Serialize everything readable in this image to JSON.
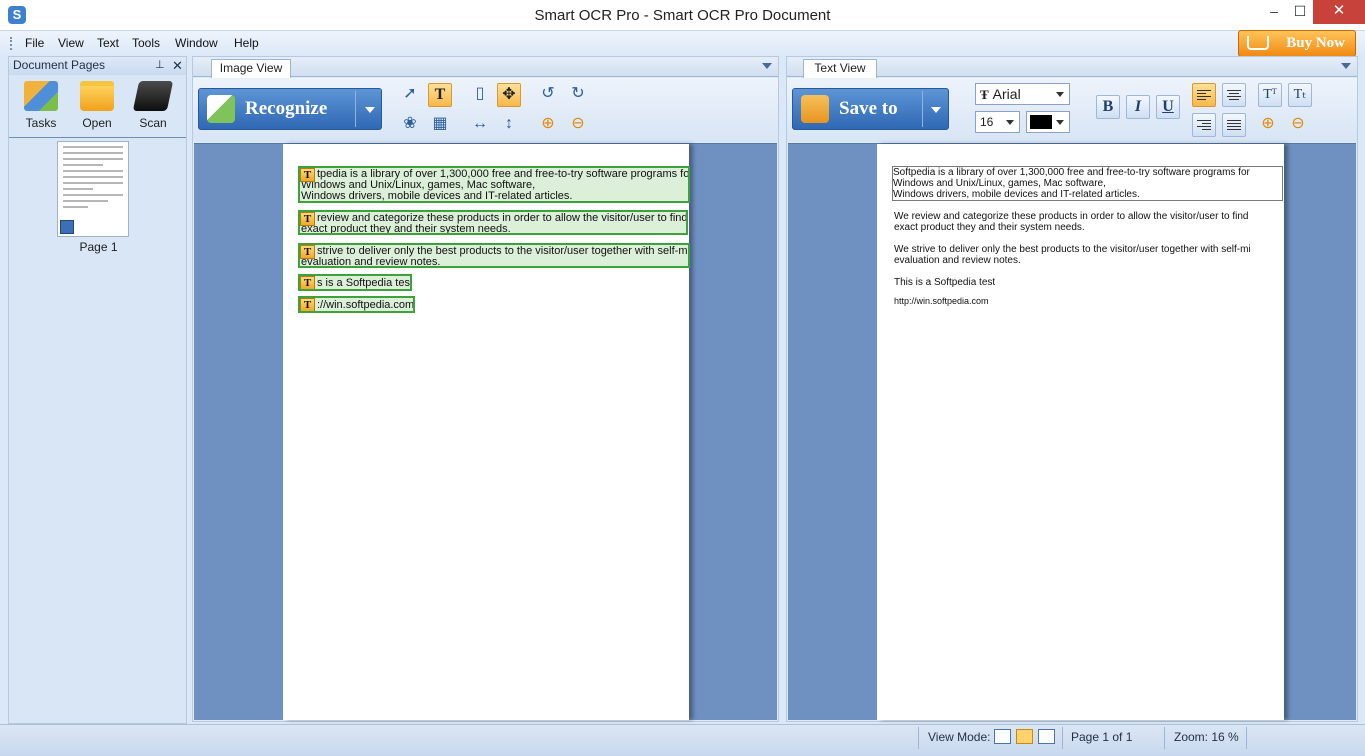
{
  "window": {
    "title": "Smart OCR Pro - Smart OCR Pro Document",
    "app_icon": "S",
    "minimize": "–",
    "maximize": "☐",
    "close": "✕"
  },
  "menu": [
    "File",
    "View",
    "Text",
    "Tools",
    "Window",
    "Help"
  ],
  "buy_now": "Buy Now",
  "doc_panel": {
    "title": "Document Pages",
    "pin": "⊥",
    "close": "✕",
    "tools": [
      "Tasks",
      "Open",
      "Scan"
    ],
    "pages": [
      "Page 1"
    ]
  },
  "image_view": {
    "tab": "Image View",
    "recognize_label": "Recognize",
    "blocks": [
      [
        "tpedia is a library of over 1,300,000 free and free-to-try software programs for",
        "Windows and Unix/Linux, games, Mac software,",
        "Windows drivers, mobile devices and IT-related articles."
      ],
      [
        " review and categorize these products in order to allow the visitor/user to find",
        "exact product they and their system needs."
      ],
      [
        " strive to deliver only the best products to the visitor/user together with self-ma",
        "evaluation and review notes."
      ],
      [
        "s is a Softpedia test"
      ],
      [
        "://win.softpedia.com"
      ]
    ]
  },
  "text_view": {
    "tab": "Text View",
    "save_label": "Save to",
    "font_name": "Arial",
    "font_size": "16",
    "bold": "B",
    "italic": "I",
    "underline": "U",
    "paragraphs": [
      [
        "Softpedia is a library of over 1,300,000 free and free-to-try software programs for",
        "Windows and Unix/Linux, games, Mac software,",
        "Windows drivers, mobile devices and IT-related articles."
      ],
      [
        "We review and categorize these products in order to allow the visitor/user to find",
        "exact product they and their system needs."
      ],
      [
        "We strive to deliver only the best products to the visitor/user together with self-mi",
        "evaluation and review notes."
      ],
      [
        "This is a Softpedia test"
      ],
      [
        "http://win.softpedia.com"
      ]
    ]
  },
  "status": {
    "view_mode_label": "View Mode:",
    "page": "Page 1 of 1",
    "zoom": "Zoom: 16 %"
  },
  "colors": {
    "accent": "#2f68b4",
    "canvas": "#6f91c2",
    "recognized_block": "#3ea23a",
    "buy_now": "#f08a12",
    "close_button": "#c7423b"
  }
}
